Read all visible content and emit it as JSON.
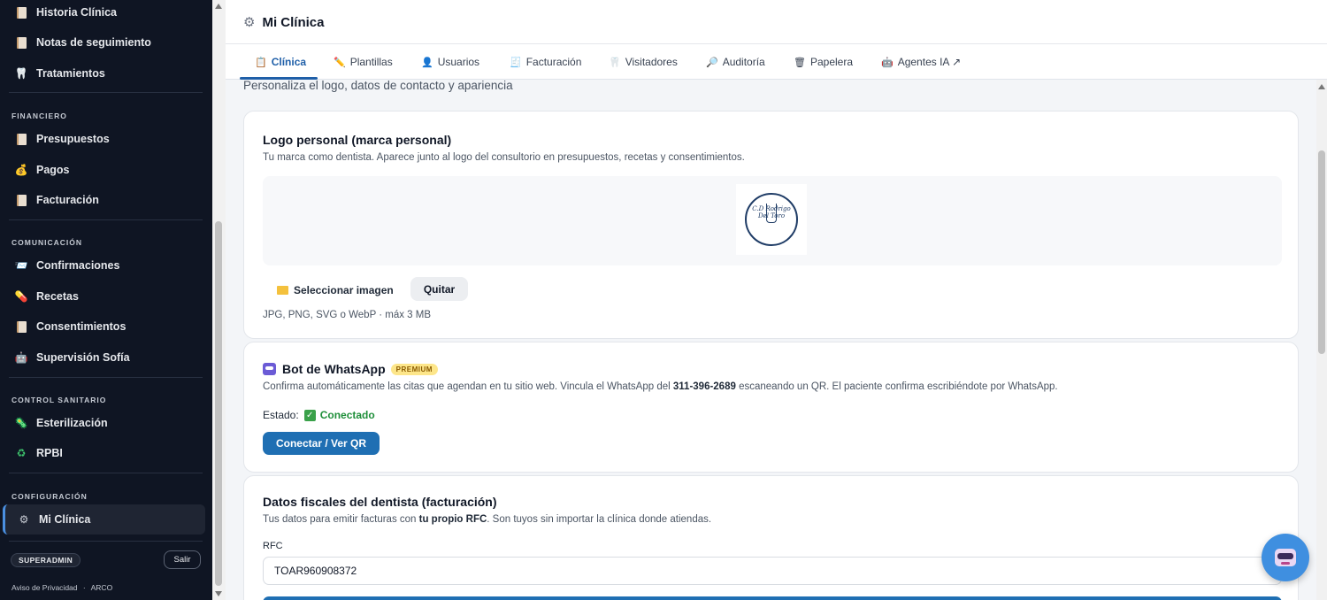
{
  "sidebar": {
    "top_items": [
      {
        "label": "Historia Clínica"
      },
      {
        "label": "Notas de seguimiento"
      },
      {
        "label": "Tratamientos"
      }
    ],
    "sections": {
      "financiero": {
        "label": "FINANCIERO",
        "items": [
          {
            "label": "Presupuestos"
          },
          {
            "label": "Pagos"
          },
          {
            "label": "Facturación"
          }
        ]
      },
      "comunicacion": {
        "label": "COMUNICACIÓN",
        "items": [
          {
            "label": "Confirmaciones"
          },
          {
            "label": "Recetas"
          },
          {
            "label": "Consentimientos"
          },
          {
            "label": "Supervisión Sofía"
          }
        ]
      },
      "control": {
        "label": "CONTROL SANITARIO",
        "items": [
          {
            "label": "Esterilización"
          },
          {
            "label": "RPBI"
          }
        ]
      },
      "configuracion": {
        "label": "CONFIGURACIÓN",
        "items": [
          {
            "label": "Mi Clínica",
            "active": true
          }
        ]
      }
    },
    "role_badge": "SUPERADMIN",
    "logout_label": "Salir",
    "footer": {
      "privacy": "Aviso de Privacidad",
      "separator": "·",
      "arco": "ARCO"
    }
  },
  "header": {
    "title": "Mi Clínica"
  },
  "tabs": [
    {
      "label": "Clínica",
      "active": true
    },
    {
      "label": "Plantillas"
    },
    {
      "label": "Usuarios"
    },
    {
      "label": "Facturación"
    },
    {
      "label": "Visitadores"
    },
    {
      "label": "Auditoría"
    },
    {
      "label": "Papelera"
    },
    {
      "label": "Agentes IA ↗"
    }
  ],
  "page_subtitle": "Personaliza el logo, datos de contacto y apariencia",
  "logo_card": {
    "title": "Logo personal (marca personal)",
    "description": "Tu marca como dentista. Aparece junto al logo del consultorio en presupuestos, recetas y consentimientos.",
    "logo_text_line1": "C.D Rodrigo",
    "logo_text_line2": "Del Toro",
    "select_label": "Seleccionar imagen",
    "remove_label": "Quitar",
    "hint": "JPG, PNG, SVG o WebP · máx 3 MB"
  },
  "whatsapp_card": {
    "title": "Bot de WhatsApp",
    "badge": "PREMIUM",
    "desc_part1": "Confirma automáticamente las citas que agendan en tu sitio web. Vincula el WhatsApp del ",
    "phone": "311-396-2689",
    "desc_part2": " escaneando un QR. El paciente confirma escribiéndote por WhatsApp.",
    "status_label": "Estado:",
    "status_value": "Conectado",
    "qr_button": "Conectar / Ver QR"
  },
  "fiscal_card": {
    "title": "Datos fiscales del dentista (facturación)",
    "desc_part1": "Tus datos para emitir facturas con ",
    "desc_bold": "tu propio RFC",
    "desc_part2": ". Son tuyos sin importar la clínica donde atiendas.",
    "rfc_label": "RFC",
    "rfc_value": "TOAR960908372"
  },
  "colors": {
    "sidebar_bg": "#0f1523",
    "accent": "#1f6fb3",
    "status_green": "#1f8f3a",
    "premium": "#fde68a"
  }
}
